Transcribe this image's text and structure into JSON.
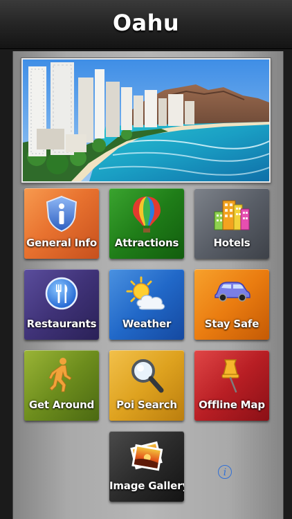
{
  "header": {
    "title": "Oahu"
  },
  "hero": {
    "image_icon": "waikiki-beach-photo"
  },
  "menu": {
    "items": [
      {
        "label": "General Info",
        "icon": "info-shield-icon",
        "color": "#e8722f"
      },
      {
        "label": "Attractions",
        "icon": "hot-air-balloon-icon",
        "color": "#1f7d18"
      },
      {
        "label": "Hotels",
        "icon": "buildings-icon",
        "color": "#595e67"
      },
      {
        "label": "Restaurants",
        "icon": "fork-knife-icon",
        "color": "#3f3277"
      },
      {
        "label": "Weather",
        "icon": "sun-cloud-icon",
        "color": "#2168c8"
      },
      {
        "label": "Stay Safe",
        "icon": "car-icon",
        "color": "#ea7c10"
      },
      {
        "label": "Get Around",
        "icon": "walking-person-icon",
        "color": "#6d8d1d"
      },
      {
        "label": "Poi Search",
        "icon": "magnifier-icon",
        "color": "#dea21f"
      },
      {
        "label": "Offline Map",
        "icon": "map-pin-icon",
        "color": "#b81e24"
      },
      {
        "label": "Image Gallery",
        "icon": "photo-stack-icon",
        "color": "#2b2b2b"
      }
    ]
  },
  "info_button": {
    "label": "i",
    "color": "#2f6fd6"
  }
}
